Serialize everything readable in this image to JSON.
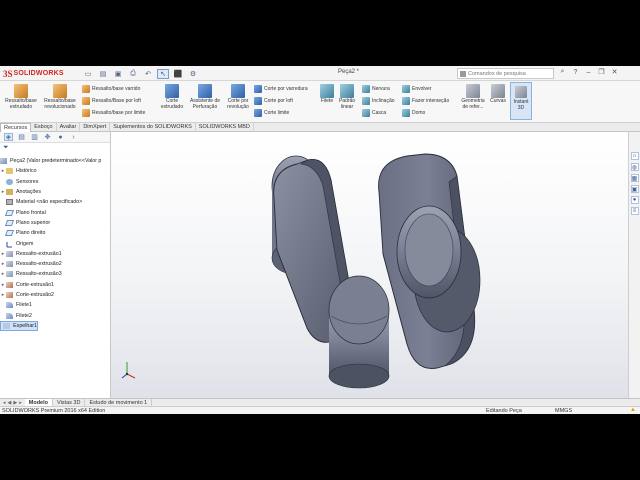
{
  "app": {
    "brand_prefix": "3S",
    "brand_name": "SOLIDWORKS",
    "document_title": "Peça2 *",
    "search_placeholder": "Comandos de pesquisa"
  },
  "quick_access": {
    "icons": [
      "new-icon",
      "open-icon",
      "save-icon",
      "print-icon",
      "undo-icon",
      "select-icon",
      "rebuild-icon",
      "options-icon"
    ]
  },
  "command_manager": {
    "big_buttons": [
      {
        "label": "Ressalto/base\nextrudado"
      },
      {
        "label": "Ressalto/base\nrevolucionado"
      },
      {
        "label": "Corte\nextrudado"
      },
      {
        "label": "Assistente de\nPerfuração"
      },
      {
        "label": "Corte por\nrevolução"
      },
      {
        "label": "Filete"
      },
      {
        "label": "Padrão\nlinear"
      },
      {
        "label": "Geometria\nde refer..."
      },
      {
        "label": "Curvas"
      }
    ],
    "group1": [
      "Ressalto/base varrido",
      "Ressalto/Base por loft",
      "Ressalto/base por limite"
    ],
    "group2": [
      "Corte por varredura",
      "Corte por loft",
      "Corte limite"
    ],
    "group3": [
      "Nervura",
      "Inclinação",
      "Casca"
    ],
    "group4": [
      "Envolver",
      "Fazer interseção",
      "Domo"
    ],
    "instant3d": "Instant\n3D"
  },
  "tabs": [
    "Recursos",
    "Esboço",
    "Avaliar",
    "DimXpert",
    "Suplementos do SOLIDWORKS",
    "SOLIDWORKS MBD"
  ],
  "active_tab": "Recursos",
  "feature_tree": {
    "root": "Peça2  (Valor predeterminado<<Valor p",
    "items": [
      {
        "label": "Histórico",
        "expandable": true,
        "icon": "history-folder-icon"
      },
      {
        "label": "Sensores",
        "expandable": false,
        "icon": "sensor-icon"
      },
      {
        "label": "Anotações",
        "expandable": true,
        "icon": "annotations-icon"
      },
      {
        "label": "Material <não especificado>",
        "expandable": false,
        "icon": "material-icon"
      },
      {
        "label": "Plano frontal",
        "expandable": false,
        "icon": "plane-icon"
      },
      {
        "label": "Plano superior",
        "expandable": false,
        "icon": "plane-icon"
      },
      {
        "label": "Plano direito",
        "expandable": false,
        "icon": "plane-icon"
      },
      {
        "label": "Origem",
        "expandable": false,
        "icon": "origin-icon"
      },
      {
        "label": "Ressalto-extrusão1",
        "expandable": true,
        "icon": "extrude-icon"
      },
      {
        "label": "Ressalto-extrusão2",
        "expandable": true,
        "icon": "extrude-icon"
      },
      {
        "label": "Ressalto-extrusão3",
        "expandable": true,
        "icon": "extrude-icon"
      },
      {
        "label": "Corte-extrusão1",
        "expandable": true,
        "icon": "cut-icon"
      },
      {
        "label": "Corte-extrusão2",
        "expandable": true,
        "icon": "cut-icon"
      },
      {
        "label": "Filete1",
        "expandable": false,
        "icon": "fillet-icon"
      },
      {
        "label": "Filete2",
        "expandable": false,
        "icon": "fillet-icon"
      },
      {
        "label": "Espelhar1",
        "expandable": false,
        "icon": "mirror-icon",
        "selected": true
      }
    ]
  },
  "bottom_tabs": [
    "Modelo",
    "Vistas 3D",
    "Estudo de movimento 1"
  ],
  "status": {
    "edition": "SOLIDWORKS Premium 2016 x64 Edition",
    "mode": "Editando Peça",
    "units": "MMGS",
    "units_arrow": "▲"
  },
  "colors": {
    "brand": "#d2231d",
    "part_face": "#7b8094",
    "part_face_dark": "#555a6b",
    "part_face_light": "#a4a8b8",
    "selection": "#cfe2f9"
  }
}
